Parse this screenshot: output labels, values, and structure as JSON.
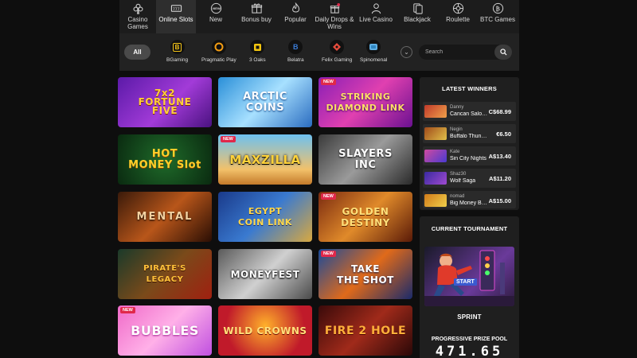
{
  "nav": {
    "items": [
      {
        "label": "Casino\nGames",
        "icon": "club-icon"
      },
      {
        "label": "Online Slots",
        "icon": "slot-machine-icon",
        "active": true
      },
      {
        "label": "New",
        "icon": "new-icon"
      },
      {
        "label": "Bonus buy",
        "icon": "gift-icon"
      },
      {
        "label": "Popular",
        "icon": "flame-icon"
      },
      {
        "label": "Daily Drops &\nWins",
        "icon": "gift-drop-icon"
      },
      {
        "label": "Live Casino",
        "icon": "dealer-icon"
      },
      {
        "label": "Blackjack",
        "icon": "cards-icon"
      },
      {
        "label": "Roulette",
        "icon": "roulette-icon"
      },
      {
        "label": "BTC Games",
        "icon": "btc-icon"
      }
    ]
  },
  "providers": {
    "all_label": "All",
    "items": [
      {
        "label": "BGaming",
        "logo": "B",
        "color": "#f5c518"
      },
      {
        "label": "Pragmatic Play",
        "logo": "●",
        "color": "#f39c12"
      },
      {
        "label": "3 Oaks",
        "logo": "■",
        "color": "#f1c40f"
      },
      {
        "label": "Belatra",
        "logo": "B",
        "color": "#3a7bd5"
      },
      {
        "label": "Felix Gaming",
        "logo": "♦",
        "color": "#e74c3c"
      },
      {
        "label": "Spinomenal",
        "logo": "S",
        "color": "#5dade2"
      }
    ],
    "search_placeholder": "Search"
  },
  "games": [
    {
      "title": "7x2\nFORTUNE\nFIVE",
      "new": false
    },
    {
      "title": "ARCTIC\nCOINS",
      "new": false
    },
    {
      "title": "STRIKING\nDIAMOND LINK",
      "new": true
    },
    {
      "title": "HOT\nMONEY Slot",
      "new": false
    },
    {
      "title": "MAXZILLA",
      "new": true
    },
    {
      "title": "SLAYERS\nINC",
      "new": false
    },
    {
      "title": "MENTAL",
      "new": false
    },
    {
      "title": "EGYPT\nCOIN LINK",
      "new": false
    },
    {
      "title": "GOLDEN\nDESTINY",
      "new": true
    },
    {
      "title": "PIRATE'S\nLEGACY",
      "new": false
    },
    {
      "title": "MONEYFEST",
      "new": false
    },
    {
      "title": "TAKE\nTHE SHOT",
      "new": true
    },
    {
      "title": "BUBBLES",
      "new": true
    },
    {
      "title": "WILD CROWNS",
      "new": false
    },
    {
      "title": "FIRE 2 HOLE",
      "new": false
    }
  ],
  "new_badge": "NEW",
  "winners": {
    "title": "LATEST WINNERS",
    "items": [
      {
        "name": "Danny",
        "game": "Cancan Saloon ...",
        "amount": "C$68.99"
      },
      {
        "name": "Negin",
        "game": "Buffalo Thunderst...",
        "amount": "€6.50"
      },
      {
        "name": "Kate",
        "game": "Sin City Nights",
        "amount": "A$13.40"
      },
      {
        "name": "Shaz30",
        "game": "Wolf Saga",
        "amount": "A$11.20"
      },
      {
        "name": "nomad",
        "game": "Big Money Bass...",
        "amount": "A$15.00"
      }
    ]
  },
  "tournament": {
    "title": "CURRENT TOURNAMENT",
    "name": "SPRINT",
    "start_label": "START",
    "prize_label": "PROGRESSIVE PRIZE POOL",
    "prize_value": "471.65"
  }
}
